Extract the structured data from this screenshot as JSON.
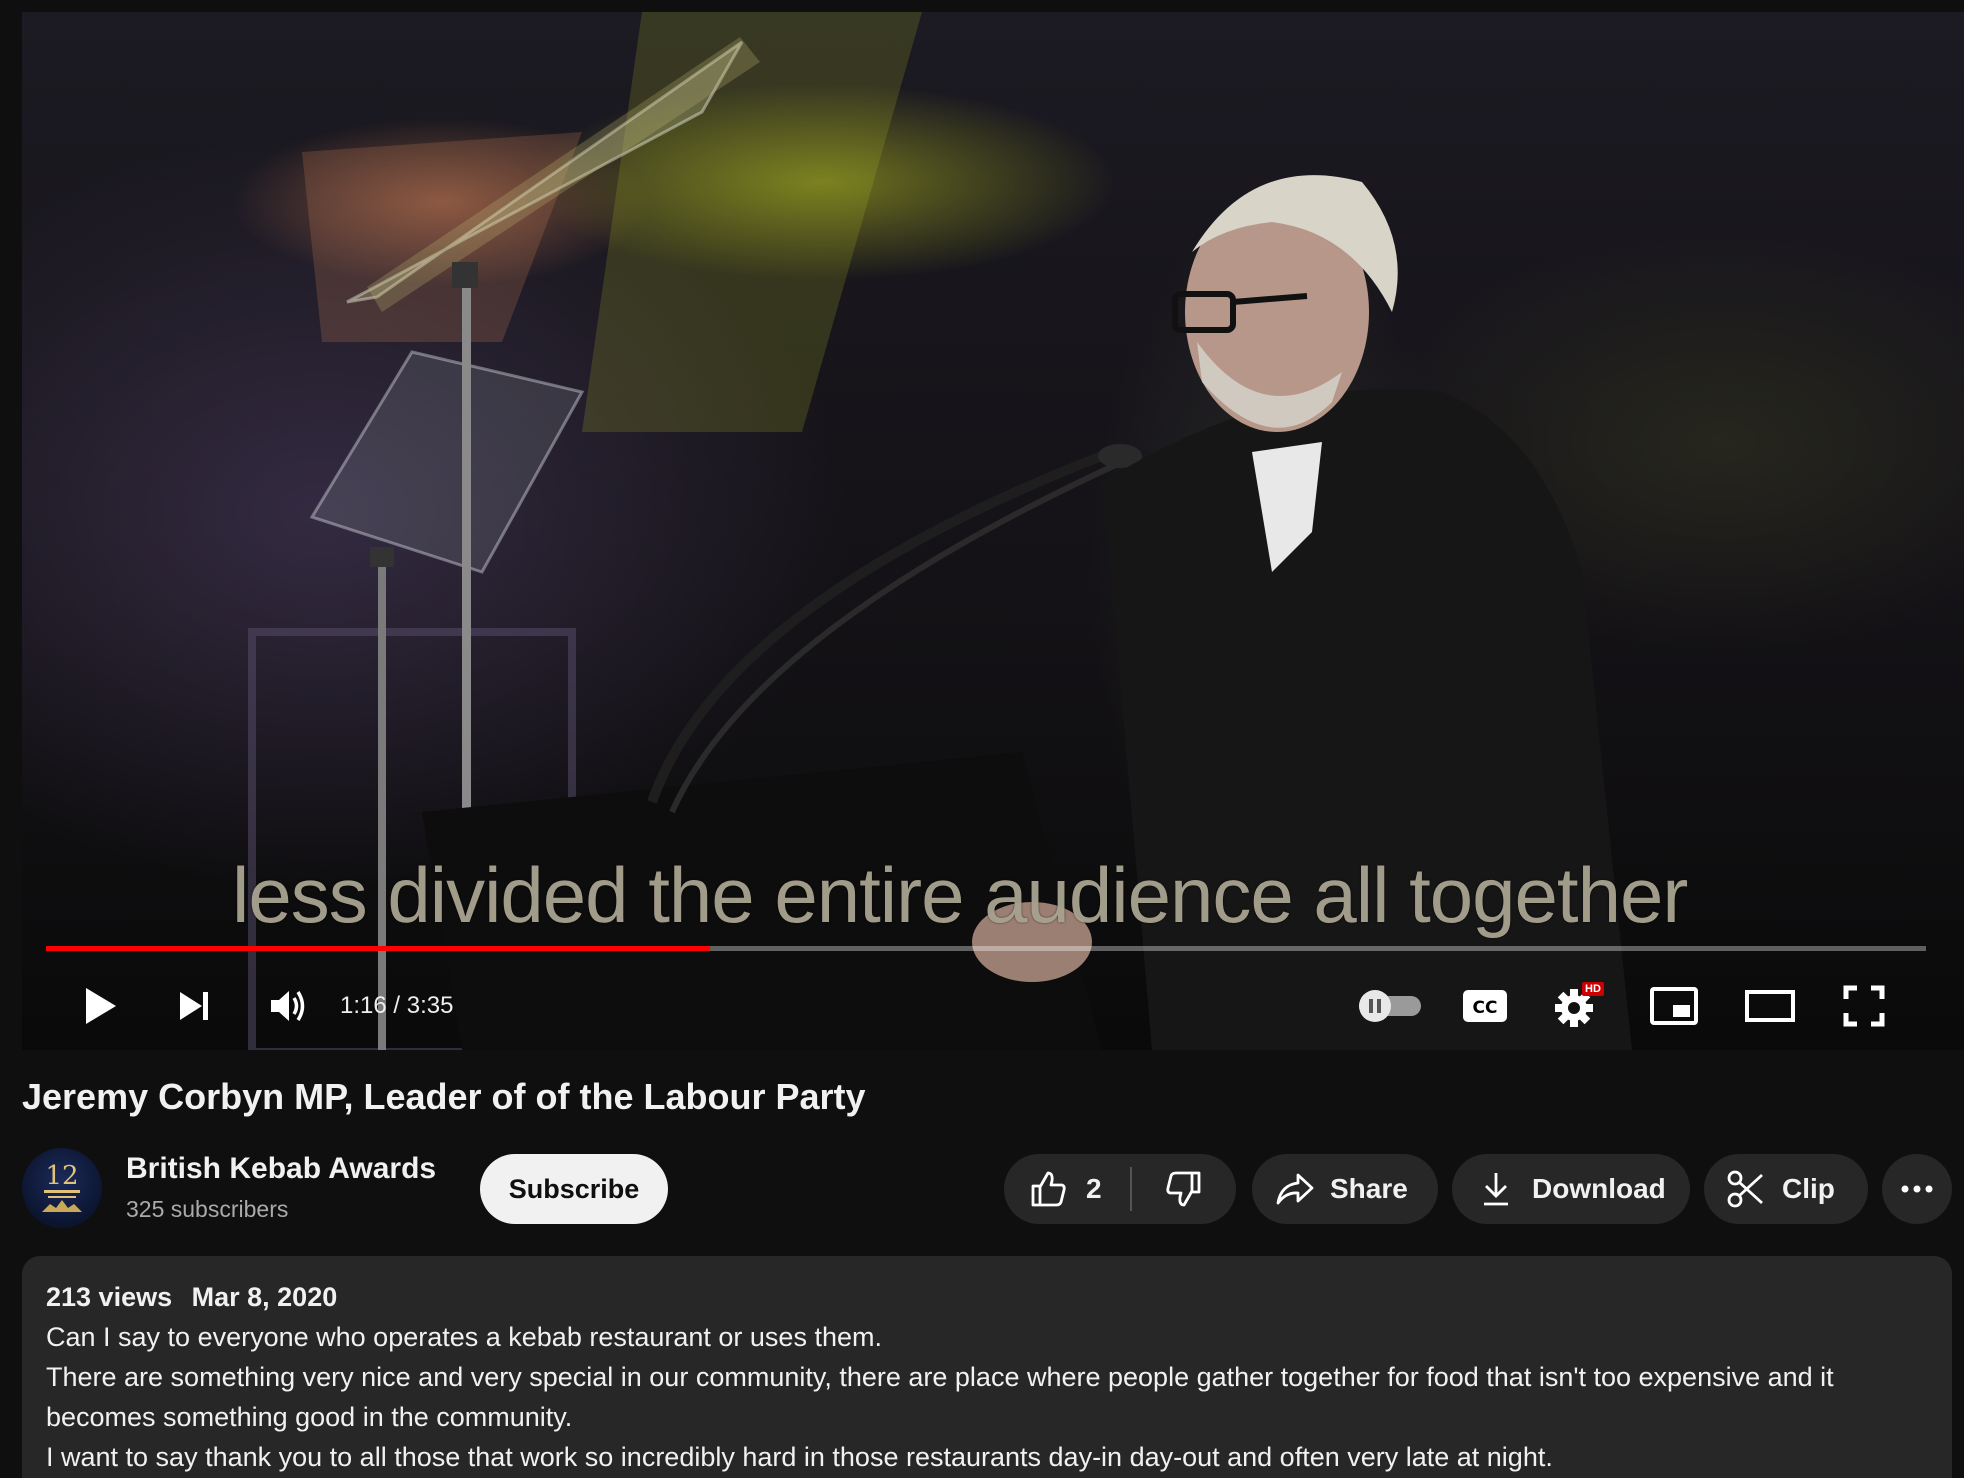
{
  "player": {
    "caption": "less divided the entire audience all together",
    "time_current": "1:16",
    "time_total": "3:35",
    "progress_fraction": 0.353,
    "accent_color": "#ff0000",
    "hd_badge": "HD",
    "icons": [
      "play-icon",
      "next-icon",
      "volume-icon",
      "autoplay-toggle-icon",
      "captions-icon",
      "settings-icon",
      "miniplayer-icon",
      "theater-icon",
      "fullscreen-icon"
    ]
  },
  "video": {
    "title": "Jeremy Corbyn MP, Leader of of the Labour Party"
  },
  "channel": {
    "name": "British Kebab Awards",
    "subscribers": "325 subscribers",
    "avatar_text": "12"
  },
  "actions": {
    "subscribe": "Subscribe",
    "like_count": "2",
    "share": "Share",
    "download": "Download",
    "clip": "Clip"
  },
  "description": {
    "views": "213 views",
    "date": "Mar 8, 2020",
    "lines": [
      "Can I say to everyone who operates a kebab restaurant or uses them.",
      "There are something very nice and very special in our community, there are place  where people gather together for food that isn't too expensive and it becomes something good in the community.",
      "I want to say thank you to all those that work so incredibly hard in those restaurants day-in day-out and often very late at night."
    ]
  }
}
